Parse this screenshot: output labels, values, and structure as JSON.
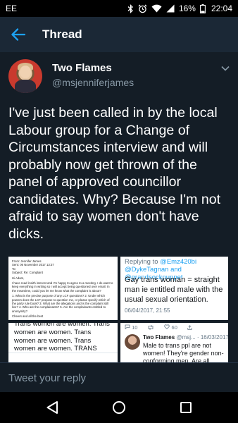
{
  "status_bar": {
    "carrier": "EE",
    "battery_percent": "16%",
    "time": "22:04"
  },
  "app_bar": {
    "title": "Thread",
    "back_icon": "arrow-left-icon"
  },
  "tweet": {
    "author_name": "Two Flames",
    "author_handle": "@msjenniferjames",
    "text": "I've just been called in by the local Labour group for a Change of Circumstances interview and will probably now get thrown of the panel of approved councillor candidates. Why? Because I'm not afraid to say women don't have dicks."
  },
  "media": {
    "email": {
      "from": "From: Jennifer James",
      "sent": "Sent: 06 November 2017 13:37",
      "to": "To: ",
      "subject": "Subject: Re: Complaint",
      "greeting": "Hi Adam,",
      "body": "I have read it with interest and I'm happy to agree to a meeting. I do want to keep everything in writing so I will accept being questioned over email. In the meantime, could you let me know what the complaint is about?",
      "questions": "1. What is the precise purpose of any LCF questions? 2. Under which powers does the LCF propose to question me, or please specify which of the party rule book? 3. What are the allegations and is the complaint still live? 4. Who are the complainants? 5. Are the complainants entitled to anonymity?",
      "signoff": "Cheers and all the best"
    },
    "reply_card": {
      "replying_to_label": "Replying to",
      "mentions": "@Emz420bi @DykeTagnan and @grandsockpuppet",
      "text": "Gay trans woman = straight man ie entitled male with the usual sexual orientation.",
      "date": "06/04/2017, 21:55"
    },
    "chant_card": {
      "text": "Trans women are women. Trans women are women. Trans women are women. Trans women are women. TRANS WOMEN ARE WOMEN."
    },
    "quote_card": {
      "reply_count": "10",
      "like_count": "60",
      "author": "Two Flames",
      "handle": "@msj...",
      "date": "16/03/2017",
      "text": "Male to trans ppl are not women! They're gender non-conforming men. Are all women gender"
    }
  },
  "reply_bar": {
    "placeholder": "Tweet your reply"
  },
  "nav_bar": {
    "back_icon": "triangle-back-icon",
    "home_icon": "circle-home-icon",
    "recent_icon": "square-recents-icon"
  }
}
